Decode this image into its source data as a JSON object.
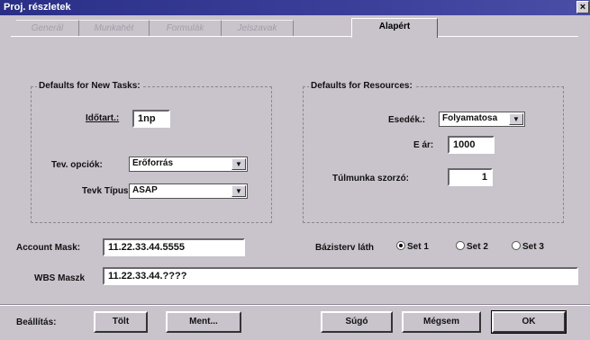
{
  "window": {
    "title": "Proj. részletek",
    "close": "×"
  },
  "tabs": [
    {
      "label": "Generál"
    },
    {
      "label": "Munkahét"
    },
    {
      "label": "Formulák"
    },
    {
      "label": "Jelszavak"
    },
    {
      "label": "Alapért"
    }
  ],
  "tasks_group": {
    "title": "Defaults for New Tasks:",
    "duration_label": "Időtart.:",
    "duration_value": "1np",
    "options_label": "Tev. opciók:",
    "options_value": "Erőforrás",
    "type_label": "Tevk Típus",
    "type_value": "ASAP"
  },
  "resources_group": {
    "title": "Defaults for Resources:",
    "accrual_label": "Esedék.:",
    "accrual_value": "Folyamatosa",
    "rate_label": "E ár:",
    "rate_value": "1000",
    "overtime_label": "Túlmunka szorzó:",
    "overtime_value": "1"
  },
  "account_mask": {
    "label": "Account Mask:",
    "value": "11.22.33.44.5555"
  },
  "baseline": {
    "label": "Bázisterv láth",
    "options": [
      "Set 1",
      "Set 2",
      "Set 3"
    ],
    "selected": "Set 1"
  },
  "wbs_mask": {
    "label": "WBS Maszk",
    "value": "11.22.33.44.????"
  },
  "footer": {
    "settings_label": "Beállítás:",
    "load": "Tölt",
    "save": "Ment...",
    "help": "Súgó",
    "cancel": "Mégsem",
    "ok": "OK"
  }
}
